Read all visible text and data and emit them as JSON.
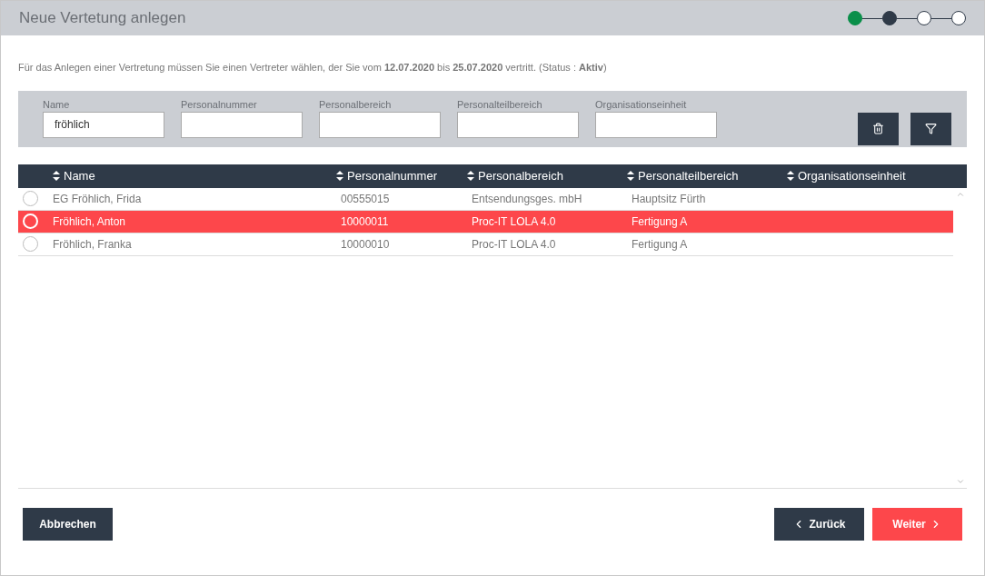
{
  "window": {
    "title": "Neue Vertetung anlegen"
  },
  "steps": [
    {
      "kind": "done"
    },
    {
      "kind": "current"
    },
    {
      "kind": "todo"
    },
    {
      "kind": "todo"
    }
  ],
  "info": "Für das Anlegen einer Vertretung müssen Sie einen Vertreter wählen, der Sie vom **12.07.2020** bis **25.07.2020** vertritt. (Status : **Aktiv**)",
  "filters": [
    {
      "label": "Name",
      "value": "fröhlich"
    },
    {
      "label": "Personalnummer"
    },
    {
      "label": "Personalbereich"
    },
    {
      "label": "Personalteilbereich"
    },
    {
      "label": "Organisationseinheit"
    }
  ],
  "table": {
    "columns": [
      "Name",
      "Personalnummer",
      "Personalbereich",
      "Personalteilbereich",
      "Organisationseinheit"
    ],
    "rows": [
      {
        "selected": false,
        "cells": [
          "EG Fröhlich, Frida",
          "00555015",
          "Entsendungsges. mbH",
          "Hauptsitz Fürth"
        ]
      },
      {
        "selected": true,
        "cells": [
          "Fröhlich, Anton",
          "10000011",
          "Proc-IT LOLA 4.0",
          "Fertigung A"
        ]
      },
      {
        "selected": false,
        "cells": [
          "Fröhlich, Franka",
          "10000010",
          "Proc-IT LOLA 4.0",
          "Fertigung A"
        ]
      }
    ]
  },
  "buttons": {
    "cancel": "Abbrechen",
    "back": "Zurück",
    "next": "Weiter"
  }
}
